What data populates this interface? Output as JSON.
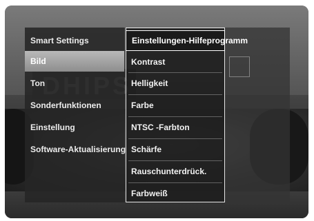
{
  "left_menu": {
    "header": "Smart Settings",
    "items": [
      {
        "label": "Bild",
        "selected": true
      },
      {
        "label": "Ton",
        "selected": false
      },
      {
        "label": "Sonderfunktionen",
        "selected": false
      },
      {
        "label": "Einstellung",
        "selected": false
      },
      {
        "label": "Software-Aktualisierung",
        "selected": false
      }
    ]
  },
  "mid_menu": {
    "items": [
      {
        "label": "Einstellungen-Hilfeprogramm",
        "highlighted": true
      },
      {
        "label": "Kontrast",
        "highlighted": false
      },
      {
        "label": "Helligkeit",
        "highlighted": false
      },
      {
        "label": "Farbe",
        "highlighted": false
      },
      {
        "label": "NTSC -Farbton",
        "highlighted": false
      },
      {
        "label": "Schärfe",
        "highlighted": false
      },
      {
        "label": "Rauschunterdrück.",
        "highlighted": false
      },
      {
        "label": "Farbweiß",
        "highlighted": false
      }
    ]
  },
  "background": {
    "banner_text": "DHIPS"
  },
  "colors": {
    "selected_bg": "#a0a0a0",
    "panel_bg": "#262626",
    "text": "#ececec"
  }
}
